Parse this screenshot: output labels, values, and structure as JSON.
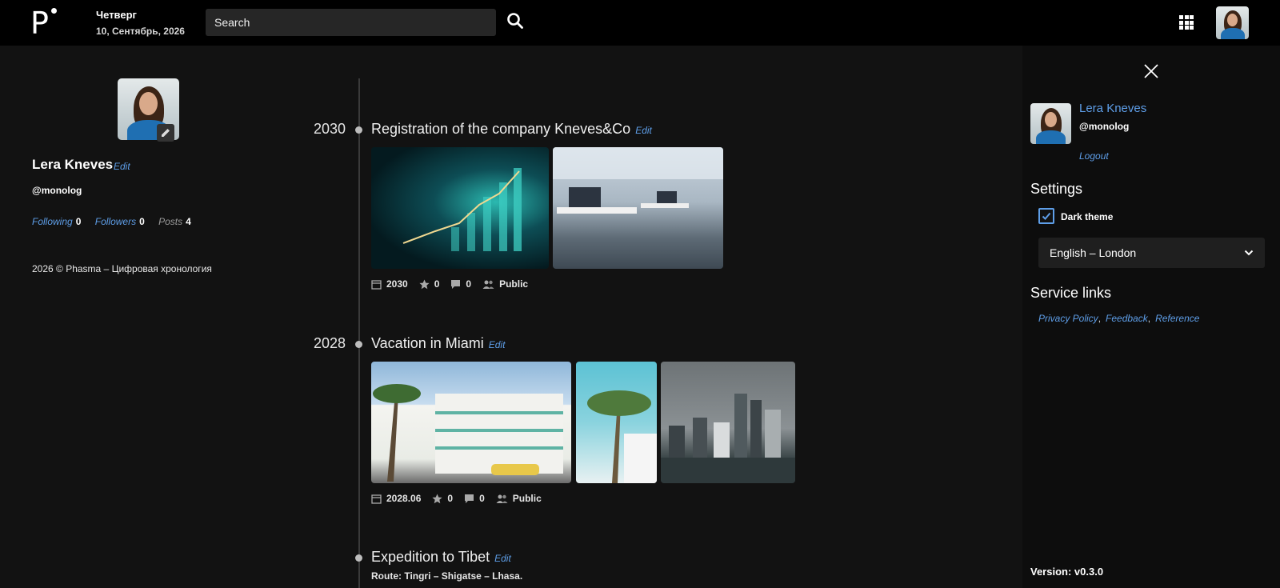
{
  "header": {
    "logo_letter": "P",
    "day": "Четверг",
    "date": "10, Сентябрь, 2026",
    "search_placeholder": "Search"
  },
  "icons": {
    "search": "search-icon",
    "apps": "apps-grid-icon",
    "close": "close-icon",
    "pencil": "pencil-icon",
    "calendar": "calendar-icon",
    "star": "star-icon",
    "comment": "comment-icon",
    "visibility": "people-icon"
  },
  "colors": {
    "background": "#121212",
    "topbar": "#000000",
    "accent_link": "#5e9ee8",
    "panel": "#0d0d0d"
  },
  "profile": {
    "name": "Lera Kneves",
    "edit_label": "Edit",
    "handle": "@monolog",
    "following_label": "Following",
    "following_count": "0",
    "followers_label": "Followers",
    "followers_count": "0",
    "posts_label": "Posts",
    "posts_count": "4",
    "copyright": "2026 © Phasma – Цифровая хронология"
  },
  "timeline": [
    {
      "year": "2030",
      "title": "Registration of the company Kneves&Co",
      "edit_label": "Edit",
      "photos": [
        "growth-chart-photo",
        "office-photo"
      ],
      "meta": {
        "date": "2030",
        "stars": "0",
        "comments": "0",
        "visibility": "Public"
      }
    },
    {
      "year": "2028",
      "title": "Vacation in Miami",
      "edit_label": "Edit",
      "photos": [
        "art-deco-hotel-photo",
        "palm-tree-photo",
        "miami-skyline-photo"
      ],
      "meta": {
        "date": "2028.06",
        "stars": "0",
        "comments": "0",
        "visibility": "Public"
      }
    },
    {
      "year": "",
      "title": "Expedition to Tibet",
      "edit_label": "Edit",
      "route": "Route: Tingri – Shigatse – Lhasa."
    }
  ],
  "panel": {
    "name": "Lera Kneves",
    "handle": "@monolog",
    "logout": "Logout",
    "settings_title": "Settings",
    "dark_theme_label": "Dark theme",
    "dark_theme_checked": true,
    "language": "English – London",
    "service_links_title": "Service links",
    "service_links": [
      "Privacy Policy",
      "Feedback",
      "Reference"
    ],
    "version_label": "Version:",
    "version_value": "v0.3.0"
  }
}
